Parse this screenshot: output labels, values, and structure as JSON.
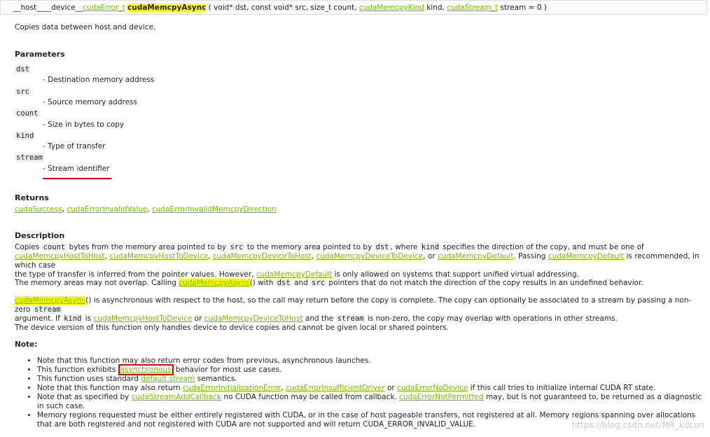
{
  "signature": {
    "prefix": "__host____device__",
    "ret_type": "cudaError_t",
    "func_name": "cudaMemcpyAsync",
    "open": " ( void* dst, const void* src, size_t count, ",
    "kind_type": "cudaMemcpyKind",
    "kind_tail": " kind, ",
    "stream_type": "cudaStream_t",
    "stream_tail": " stream = 0 )"
  },
  "summary": "Copies data between host and device.",
  "parameters": {
    "title": "Parameters",
    "items": [
      {
        "name": "dst",
        "desc": "- Destination memory address"
      },
      {
        "name": "src",
        "desc": "- Source memory address"
      },
      {
        "name": "count",
        "desc": "- Size in bytes to copy"
      },
      {
        "name": "kind",
        "desc": "- Type of transfer"
      },
      {
        "name": "stream",
        "desc": "- Stream identifier"
      }
    ]
  },
  "returns": {
    "title": "Returns",
    "codes": [
      "cudaSuccess",
      "cudaErrorInvalidValue",
      "cudaErrorInvalidMemcpyDirection"
    ],
    "sep": ", "
  },
  "description": {
    "title": "Description",
    "p1": {
      "t1": "Copies ",
      "c1": "count",
      "t2": " bytes from the memory area pointed to by ",
      "c2": "src",
      "t3": " to the memory area pointed to by ",
      "c3": "dst",
      "t4": ", where ",
      "c4": "kind",
      "t5": " specifies the direction of the copy, and must be one of",
      "l1": "cudaMemcpyHostToHost",
      "s1": ", ",
      "l2": "cudaMemcpyHostToDevice",
      "s2": ", ",
      "l3": "cudaMemcpyDeviceToHost",
      "s3": ", ",
      "l4": "cudaMemcpyDeviceToDevice",
      "s4": ", or ",
      "l5": "cudaMemcpyDefault",
      "t6": ". Passing ",
      "l6": "cudaMemcpyDefault",
      "t7": " is recommended, in which case",
      "t8": "the type of transfer is inferred from the pointer values. However, ",
      "l7": "cudaMemcpyDefault",
      "t9": " is only allowed on systems that support unified virtual addressing."
    },
    "p2": {
      "t1": "The memory areas may not overlap. Calling ",
      "l1": "cudaMemcpyAsync",
      "t2": "() with ",
      "c1": "dst",
      "t3": " and ",
      "c2": "src",
      "t4": " pointers that do not match the direction of the copy results in an undefined behavior."
    },
    "p3": {
      "l1": "cudaMemcpyAsync",
      "t1": "() is asynchronous with respect to the host, so the call may return before the copy is complete. The copy can optionally be associated to a stream by passing a non-zero ",
      "c1": "stream",
      "t2": "argument. If ",
      "c2": "kind",
      "t3": " is ",
      "l2": "cudaMemcpyHostToDevice",
      "t4": " or ",
      "l3": "cudaMemcpyDeviceToHost",
      "t5": " and the ",
      "c3": "stream",
      "t6": " is non-zero, the copy may overlap with operations in other streams."
    },
    "p4": "The device version of this function only handles device to device copies and cannot be given local or shared pointers."
  },
  "note": {
    "title": "Note:",
    "n1": "Note that this function may also return error codes from previous, asynchronous launches.",
    "n2a": "This function exhibits ",
    "n2l": "asynchronous",
    "n2b": " behavior for most use cases.",
    "n3a": "This function uses standard ",
    "n3l": "default stream",
    "n3b": " semantics.",
    "n4a": "Note that this function may also return ",
    "n4l1": "cudaErrorInitializationError",
    "n4s1": ", ",
    "n4l2": "cudaErrorInsufficientDriver",
    "n4s2": " or ",
    "n4l3": "cudaErrorNoDevice",
    "n4b": " if this call tries to initialize internal CUDA RT state.",
    "n5a": "Note that as specified by ",
    "n5l1": "cudaStreamAddCallback",
    "n5b": " no CUDA function may be called from callback. ",
    "n5l2": "cudaErrorNotPermitted",
    "n5c": " may, but is not guaranteed to, be returned as a diagnostic in such case.",
    "n6": "Memory regions requested must be either entirely registered with CUDA, or in the case of host pageable transfers, not registered at all. Memory regions spanning over allocations that are both registered and not registered with CUDA are not supported and will return CUDA_ERROR_INVALID_VALUE."
  },
  "watermark": "https://blog.csdn.net/MR_kdcon",
  "colors": {
    "link": "#76b900",
    "highlight": "#ffff00",
    "annotation": "#e00000"
  }
}
